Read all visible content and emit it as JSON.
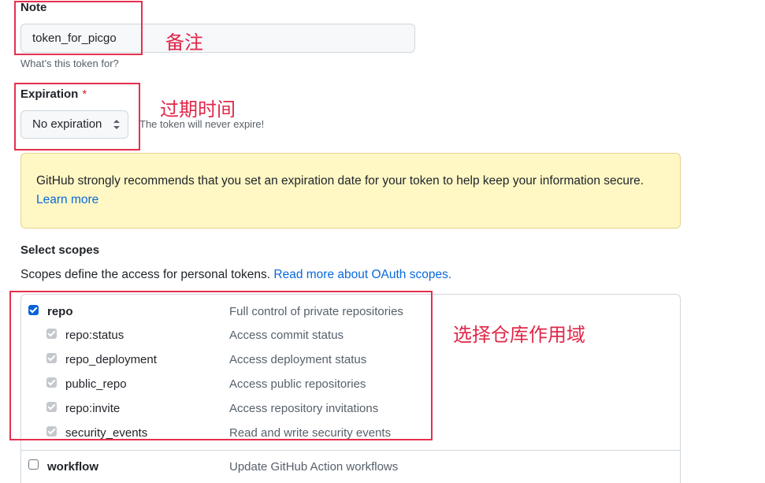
{
  "note": {
    "label": "Note",
    "value": "token_for_picgo",
    "hint": "What’s this token for?"
  },
  "expiration": {
    "label": "Expiration",
    "required_mark": "*",
    "selected": "No expiration",
    "hint": "The token will never expire!"
  },
  "flash": {
    "message": "GitHub strongly recommends that you set an expiration date for your token to help keep your information secure.",
    "link": "Learn more"
  },
  "scopes": {
    "title": "Select scopes",
    "description": "Scopes define the access for personal tokens.",
    "link": "Read more about OAuth scopes.",
    "items": [
      {
        "name": "repo",
        "desc": "Full control of private repositories",
        "state": "checked"
      },
      {
        "name": "repo:status",
        "desc": "Access commit status",
        "state": "disabled-checked"
      },
      {
        "name": "repo_deployment",
        "desc": "Access deployment status",
        "state": "disabled-checked"
      },
      {
        "name": "public_repo",
        "desc": "Access public repositories",
        "state": "disabled-checked"
      },
      {
        "name": "repo:invite",
        "desc": "Access repository invitations",
        "state": "disabled-checked"
      },
      {
        "name": "security_events",
        "desc": "Read and write security events",
        "state": "disabled-checked"
      },
      {
        "name": "workflow",
        "desc": "Update GitHub Action workflows",
        "state": "unchecked"
      }
    ]
  },
  "annotations": {
    "note": "备注",
    "expiration": "过期时间",
    "scopes": "选择仓库作用域"
  },
  "colors": {
    "annotation": "#e5304f",
    "link": "#0969da",
    "flash_bg": "#fff8c5",
    "checkbox_checked": "#0b62d6"
  }
}
